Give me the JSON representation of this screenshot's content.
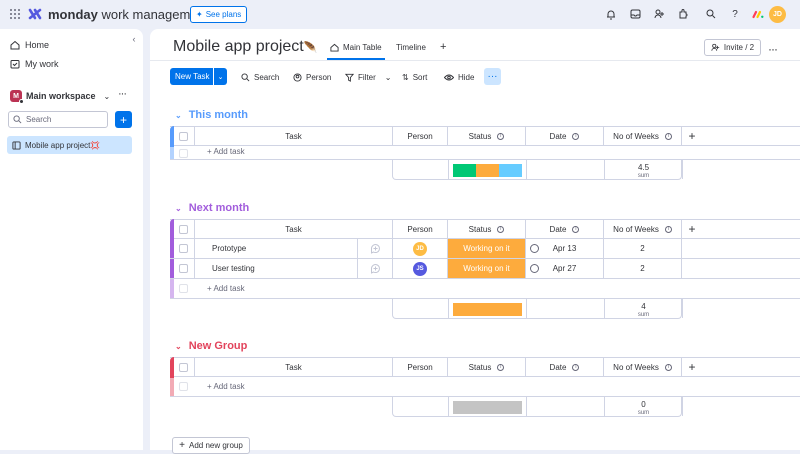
{
  "app": {
    "brand_bold": "monday",
    "brand_rest": " work management",
    "see_plans": "See plans",
    "avatar_initials": "JD",
    "colors": {
      "accent": "#0073ea",
      "brand_pink": "#ff3d57",
      "brand_yellow": "#ffcb00",
      "brand_green": "#00ca72"
    }
  },
  "topbar_icons": [
    "bell-icon",
    "inbox-icon",
    "invite-members-icon",
    "apps-icon",
    "search-icon",
    "help-icon"
  ],
  "sidebar": {
    "items": [
      {
        "label": "Home",
        "icon": "home-icon"
      },
      {
        "label": "My work",
        "icon": "my-work-icon"
      }
    ],
    "workspace": {
      "badge": "M",
      "name": "Main workspace"
    },
    "search_placeholder": "Search",
    "board": "Mobile app project💢"
  },
  "board": {
    "title": "Mobile app project",
    "tabs": [
      {
        "label": "Main Table",
        "active": true
      },
      {
        "label": "Timeline",
        "active": false
      }
    ],
    "add_view": "+",
    "invite": "Invite / 2"
  },
  "toolbar": {
    "new_task": "New Task",
    "search": "Search",
    "person": "Person",
    "filter": "Filter",
    "sort": "Sort",
    "hide": "Hide"
  },
  "columns": {
    "task": "Task",
    "person": "Person",
    "status": "Status",
    "date": "Date",
    "weeks": "No of Weeks"
  },
  "add_task": "+ Add task",
  "sum_label": "sum",
  "groups": [
    {
      "title": "This month",
      "color": "#579bfc",
      "rows": [],
      "status_summary": [
        {
          "color": "#00c875",
          "share": 0.33
        },
        {
          "color": "#fdab3d",
          "share": 0.33
        },
        {
          "color": "#66ccff",
          "share": 0.34
        }
      ],
      "sum": "4.5"
    },
    {
      "title": "Next month",
      "color": "#a25ddc",
      "rows": [
        {
          "task": "Prototype",
          "person": "JD",
          "person_color": "#fdbc44",
          "status": "Working on it",
          "status_color": "#fdab3d",
          "date": "Apr 13",
          "weeks": "2"
        },
        {
          "task": "User testing",
          "person": "JS",
          "person_color": "#5559df",
          "status": "Working on it",
          "status_color": "#fdab3d",
          "date": "Apr 27",
          "weeks": "2"
        }
      ],
      "status_summary": [
        {
          "color": "#fdab3d",
          "share": 1
        }
      ],
      "sum": "4"
    },
    {
      "title": "New Group",
      "color": "#e2445c",
      "rows": [],
      "status_summary": [
        {
          "color": "#c4c4c4",
          "share": 1
        }
      ],
      "sum": "0"
    }
  ],
  "add_group": "Add new group"
}
